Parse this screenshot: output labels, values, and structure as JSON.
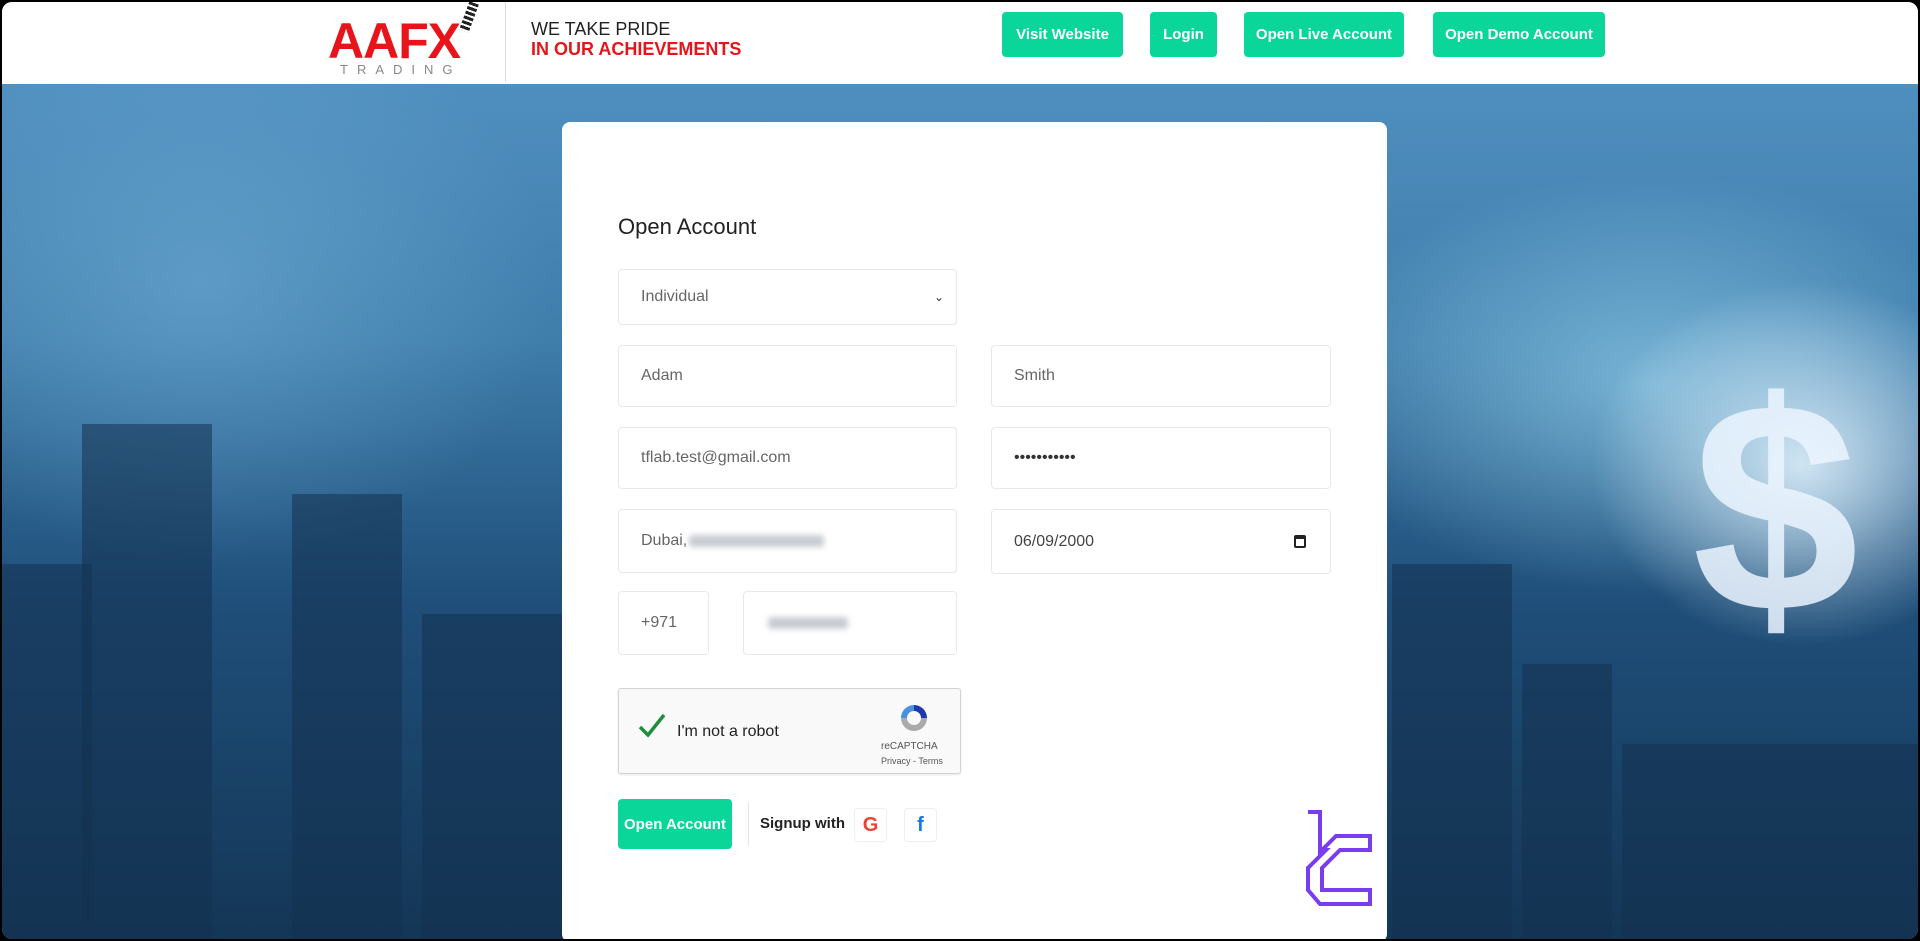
{
  "header": {
    "logo_text": "AAFX",
    "logo_sub": "TRADING",
    "tagline_1": "WE TAKE PRIDE",
    "tagline_2": "IN OUR ACHIEVEMENTS",
    "buttons": [
      "Visit Website",
      "Login",
      "Open Live Account",
      "Open Demo Account"
    ]
  },
  "form": {
    "title": "Open Account",
    "account_type": "Individual",
    "first_name": "Adam",
    "last_name": "Smith",
    "email": "tflab.test@gmail.com",
    "password": "•••••••••••",
    "address": "Dubai,",
    "dob": "06/09/2000",
    "phone_code": "+971",
    "captcha": {
      "label": "I'm not a robot",
      "brand": "reCAPTCHA",
      "links": "Privacy - Terms"
    },
    "submit": "Open Account",
    "signup_with": "Signup with",
    "social_google": "G",
    "social_facebook": "f"
  },
  "colors": {
    "accent": "#0bd69a",
    "brand_red": "#e8141b",
    "watermark": "#7a3cf0"
  }
}
